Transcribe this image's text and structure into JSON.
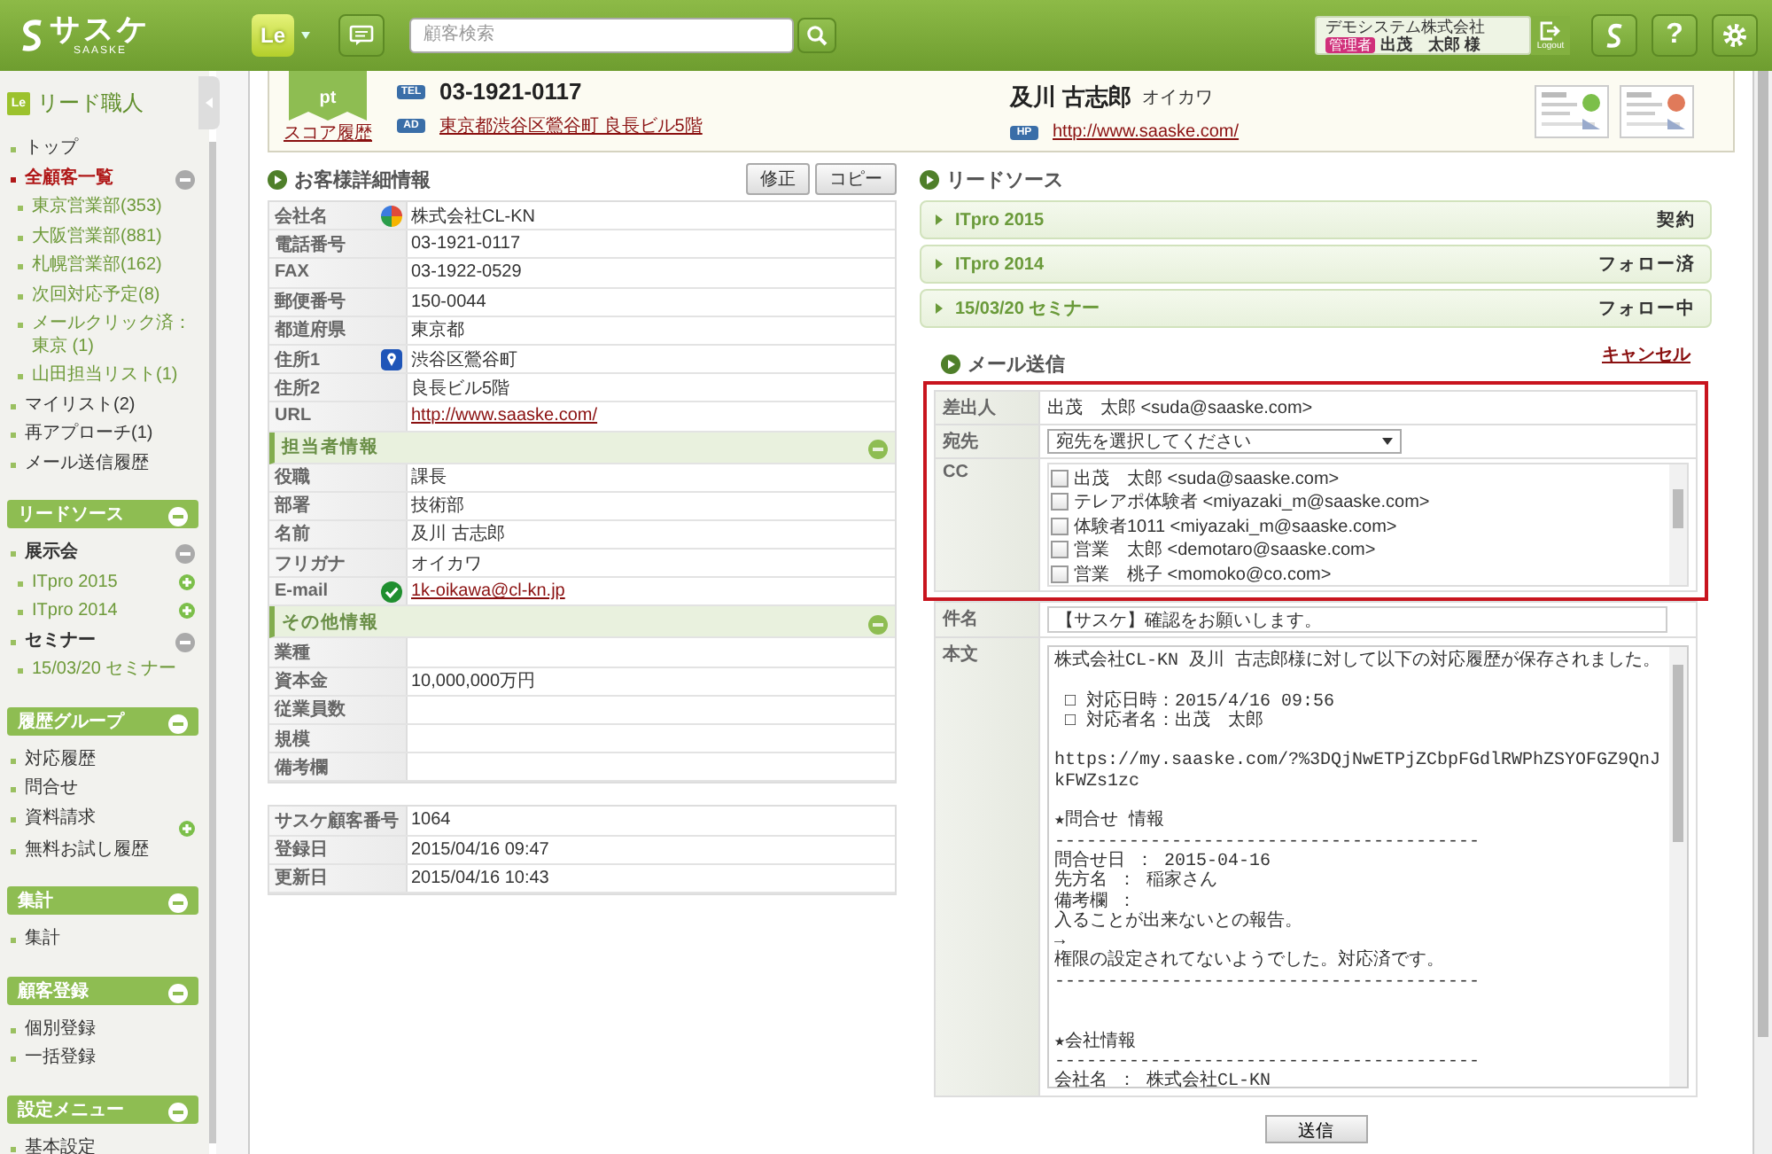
{
  "header": {
    "logo": "サスケ",
    "logo_sub": "SAASKE",
    "app_badge": "Le",
    "search": {
      "placeholder": "顧客検索"
    },
    "account": {
      "company": "デモシステム株式会社",
      "role": "管理者",
      "user": "出茂　太郎 様"
    },
    "logout": "Logout",
    "help": "?"
  },
  "sidebar": {
    "app_badge": "Le",
    "title": "リード職人",
    "nav": [
      {
        "label": "トップ",
        "selected": false
      },
      {
        "label": "全顧客一覧",
        "selected": true,
        "expanded": true,
        "children": [
          {
            "label": "東京営業部(353)",
            "selected": false
          },
          {
            "label": "大阪営業部(881)",
            "selected": false
          },
          {
            "label": "札幌営業部(162)",
            "selected": false
          },
          {
            "label": "次回対応予定(8)",
            "selected": false
          },
          {
            "label": "メールクリック済：東京 (1)",
            "selected": false
          },
          {
            "label": "山田担当リスト(1)",
            "selected": false
          }
        ]
      },
      {
        "label": "マイリスト(2)",
        "selected": false
      },
      {
        "label": "再アプローチ(1)",
        "selected": false
      },
      {
        "label": "メール送信履歴",
        "selected": false
      }
    ],
    "sections": [
      {
        "title": "リードソース",
        "expanded": true,
        "items": [
          {
            "kind": "category",
            "label": "展示会",
            "expanded": true,
            "children": [
              {
                "label": "ITpro 2015",
                "addable": true
              },
              {
                "label": "ITpro 2014",
                "addable": true
              }
            ]
          },
          {
            "kind": "category",
            "label": "セミナー",
            "expanded": true,
            "children": [
              {
                "label": "15/03/20 セミナー",
                "addable": false
              }
            ]
          }
        ]
      },
      {
        "title": "履歴グループ",
        "expanded": true,
        "items": [
          {
            "kind": "link",
            "label": "対応履歴",
            "addable": false
          },
          {
            "kind": "link",
            "label": "問合せ",
            "addable": false
          },
          {
            "kind": "link",
            "label": "資料請求",
            "addable": true
          },
          {
            "kind": "link",
            "label": "無料お試し履歴",
            "addable": false
          }
        ]
      },
      {
        "title": "集計",
        "expanded": true,
        "items": [
          {
            "kind": "link",
            "label": "集計",
            "addable": false
          }
        ]
      },
      {
        "title": "顧客登録",
        "expanded": true,
        "items": [
          {
            "kind": "link",
            "label": "個別登録",
            "addable": false
          },
          {
            "kind": "link",
            "label": "一括登録",
            "addable": false
          }
        ]
      },
      {
        "title": "設定メニュー",
        "expanded": true,
        "items": [
          {
            "kind": "link",
            "label": "基本設定",
            "addable": false
          }
        ]
      }
    ]
  },
  "summary": {
    "score_unit": "pt",
    "score_link": "スコア履歴",
    "tel_tag": "TEL",
    "tel": "03-1921-0117",
    "address_tag": "AD",
    "address": "東京都渋谷区鶯谷町 良長ビル5階",
    "name": "及川 古志郎",
    "kana": "オイカワ",
    "url_tag": "HP",
    "url": "http://www.saaske.com/"
  },
  "details": {
    "title": "お客様詳細情報",
    "buttons": [
      "修正",
      "コピー"
    ],
    "groups": [
      {
        "rows": [
          {
            "kind": "company",
            "label": "会社名",
            "value": "株式会社CL-KN"
          },
          {
            "kind": "text",
            "label": "電話番号",
            "value": "03-1921-0117"
          },
          {
            "kind": "text",
            "label": "FAX",
            "value": "03-1922-0529"
          },
          {
            "kind": "text",
            "label": "郵便番号",
            "value": "150-0044"
          },
          {
            "kind": "text",
            "label": "都道府県",
            "value": "東京都"
          },
          {
            "kind": "address",
            "label": "住所1",
            "value": "渋谷区鶯谷町"
          },
          {
            "kind": "text",
            "label": "住所2",
            "value": "良長ビル5階"
          },
          {
            "kind": "link",
            "label": "URL",
            "value": "http://www.saaske.com/"
          }
        ]
      },
      {
        "title": "担当者情報",
        "expanded": true,
        "rows": [
          {
            "kind": "text",
            "label": "役職",
            "value": "課長"
          },
          {
            "kind": "text",
            "label": "部署",
            "value": "技術部"
          },
          {
            "kind": "text",
            "label": "名前",
            "value": "及川 古志郎"
          },
          {
            "kind": "text",
            "label": "フリガナ",
            "value": "オイカワ"
          },
          {
            "kind": "email",
            "label": "E-mail",
            "value": "1k-oikawa@cl-kn.jp"
          }
        ]
      },
      {
        "title": "その他情報",
        "expanded": true,
        "rows": [
          {
            "label": "業種"
          },
          {
            "kind": "text",
            "label": "資本金",
            "value": "10,000,000万円"
          },
          {
            "label": "従業員数"
          },
          {
            "label": "規模"
          },
          {
            "label": "備考欄"
          }
        ]
      }
    ],
    "meta": [
      {
        "label": "サスケ顧客番号",
        "value": "1064"
      },
      {
        "label": "登録日",
        "value": "2015/04/16 09:47"
      },
      {
        "label": "更新日",
        "value": "2015/04/16 10:43"
      }
    ]
  },
  "lead_source": {
    "title": "リードソース",
    "items": [
      {
        "name": "ITpro 2015",
        "status": "契約",
        "expanded": false
      },
      {
        "name": "ITpro 2014",
        "status": "フォロー済",
        "expanded": false
      },
      {
        "name": "15/03/20 セミナー",
        "status": "フォロー中",
        "expanded": false
      }
    ]
  },
  "mail": {
    "title": "メール送信",
    "cancel": "キャンセル",
    "highlighted": true,
    "from_label": "差出人",
    "from": "出茂　太郎 <suda@saaske.com>",
    "to_label": "宛先",
    "to": "宛先を選択してください",
    "cc_label": "CC",
    "cc": [
      {
        "label": "出茂　太郎 <suda@saaske.com>",
        "checked": false
      },
      {
        "label": "テレアポ体験者 <miyazaki_m@saaske.com>",
        "checked": false
      },
      {
        "label": "体験者1011 <miyazaki_m@saaske.com>",
        "checked": false
      },
      {
        "label": "営業　太郎 <demotaro@saaske.com>",
        "checked": false
      },
      {
        "label": "営業　桃子 <momoko@co.com>",
        "checked": false
      }
    ],
    "subject_label": "件名",
    "subject": "【サスケ】確認をお願いします。",
    "body_label": "本文",
    "body": [
      [
        "株式会社CL-KN 及川 古志郎様に対して以下の対応履歴が保存されました。"
      ],
      [
        " □ 対応日時：2015/4/16 09:56",
        " □ 対応者名：出茂　太郎"
      ],
      [
        "https://my.saaske.com/?%3DQjNwETPjZCbpFGdlRWPhZSYOFGZ9QnJkFWZs1zc"
      ],
      [
        "★問合せ 情報",
        "----------------------------------------",
        "問合せ日 ： 2015-04-16",
        "先方名 ： 稲家さん",
        "備考欄 ：",
        "入ることが出来ないとの報告。",
        "→",
        "権限の設定されてないようでした。対応済です。",
        "----------------------------------------"
      ],
      [
        "★会社情報",
        "----------------------------------------",
        "会社名 ： 株式会社CL-KN"
      ]
    ],
    "send": "送信"
  }
}
